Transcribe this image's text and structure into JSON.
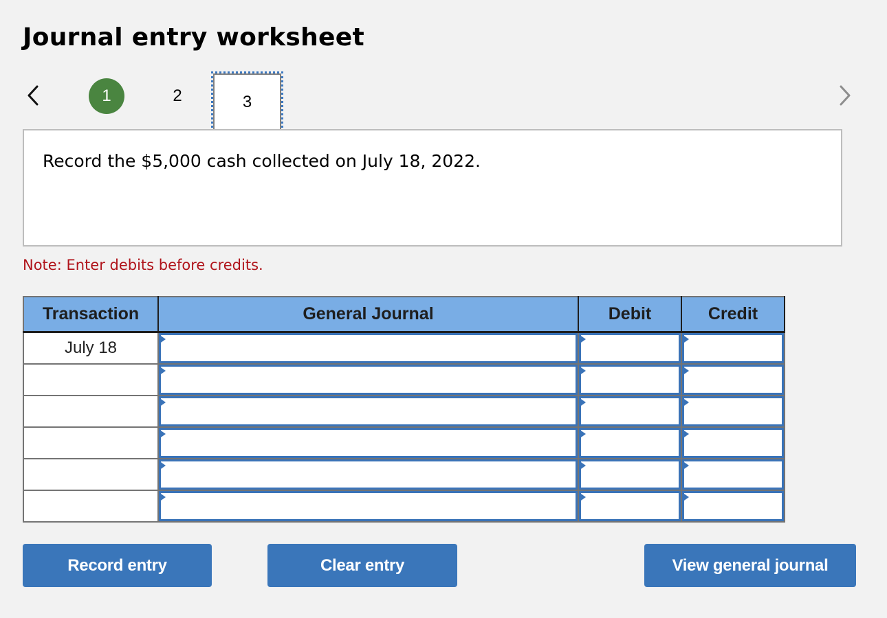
{
  "header": {
    "title": "Journal entry worksheet"
  },
  "navigation": {
    "prev_icon": "chevron-left-icon",
    "next_icon": "chevron-right-icon",
    "steps": [
      {
        "label": "1",
        "state": "completed"
      },
      {
        "label": "2",
        "state": "default"
      },
      {
        "label": "3",
        "state": "active"
      }
    ]
  },
  "question": {
    "text": "Record the $5,000 cash collected on July 18, 2022."
  },
  "note": {
    "text": "Note: Enter debits before credits."
  },
  "table": {
    "headers": {
      "transaction": "Transaction",
      "general_journal": "General Journal",
      "debit": "Debit",
      "credit": "Credit"
    },
    "rows": [
      {
        "transaction": "July 18",
        "account": "",
        "debit": "",
        "credit": ""
      },
      {
        "transaction": "",
        "account": "",
        "debit": "",
        "credit": ""
      },
      {
        "transaction": "",
        "account": "",
        "debit": "",
        "credit": ""
      },
      {
        "transaction": "",
        "account": "",
        "debit": "",
        "credit": ""
      },
      {
        "transaction": "",
        "account": "",
        "debit": "",
        "credit": ""
      },
      {
        "transaction": "",
        "account": "",
        "debit": "",
        "credit": ""
      }
    ]
  },
  "buttons": {
    "record_entry": "Record entry",
    "clear_entry": "Clear entry",
    "view_general_journal": "View general journal"
  },
  "colors": {
    "completed_step": "#4a8540",
    "header_bg": "#79ade5",
    "button_bg": "#3a76ba",
    "note_text": "#b0141b",
    "input_border": "#3a73b8"
  }
}
